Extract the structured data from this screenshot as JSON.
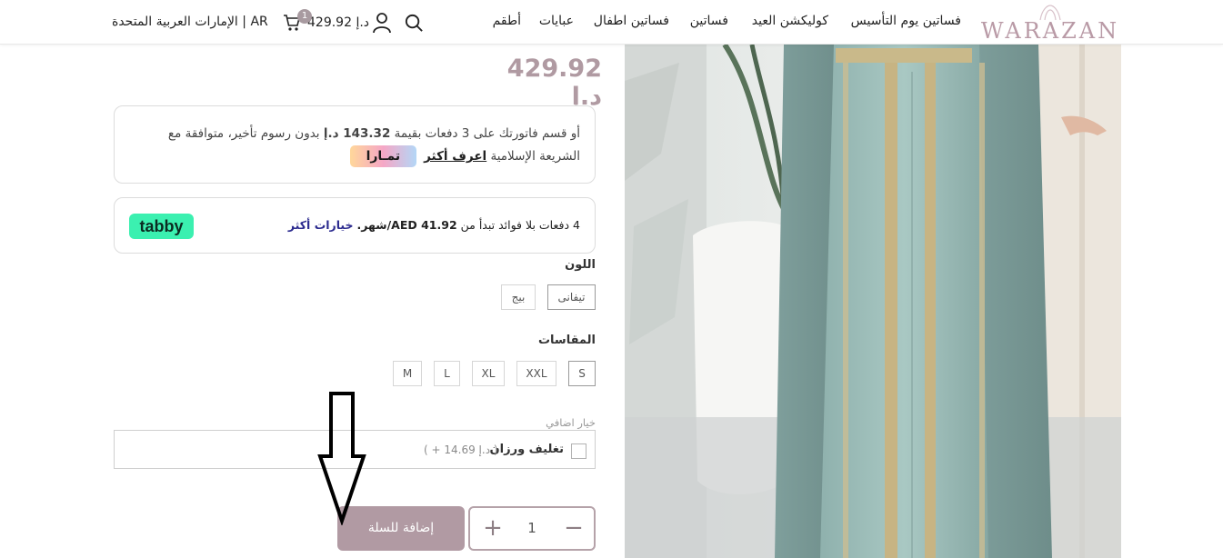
{
  "header": {
    "logo_text": "WARAZAN",
    "nav": [
      "فساتين يوم التأسيس",
      "كوليكشن العيد",
      "فساتين",
      "فساتين اطفال",
      "عبايات",
      "أطقم"
    ],
    "cart_total": "429.92 د.إ",
    "cart_count": "1",
    "region": "الإمارات العربية المتحدة | AR"
  },
  "product": {
    "price": "429.92 د.إ",
    "image_alt": "product-photo-teal-kaftan"
  },
  "tamara": {
    "line1": "أو قسم فاتورتك على 3 دفعات بقيمة",
    "amount": "143.32 د.إ",
    "line2": "بدون رسوم تأخير، متوافقة مع الشريعة الإسلامية",
    "learn_more": "اعرف أكثر",
    "badge": "تمـارا"
  },
  "tabby": {
    "text_before": "4 دفعات بلا فوائد تبدأ من",
    "amount": "AED 41.92/شهر.",
    "more": "خيارات أكثر",
    "logo": "tabby"
  },
  "color": {
    "label": "اللون",
    "options": [
      "تيفانى",
      "بيج"
    ],
    "selected": "تيفانى"
  },
  "sizes": {
    "label": "المقاسات",
    "options": [
      "S",
      "XXL",
      "XL",
      "L",
      "M"
    ],
    "selected": "S"
  },
  "extra": {
    "label": "خيار اضافي",
    "option_label": "تغليف ورزان",
    "option_price": "( + 14.69 د.إ )"
  },
  "quantity": {
    "value": "1",
    "minus": "−",
    "plus": "+"
  },
  "add_to_cart": "إضافة للسلة",
  "colors": {
    "accent": "#b19aa3",
    "price": "#b09aa2",
    "tabby_green": "#3bf0b0"
  }
}
